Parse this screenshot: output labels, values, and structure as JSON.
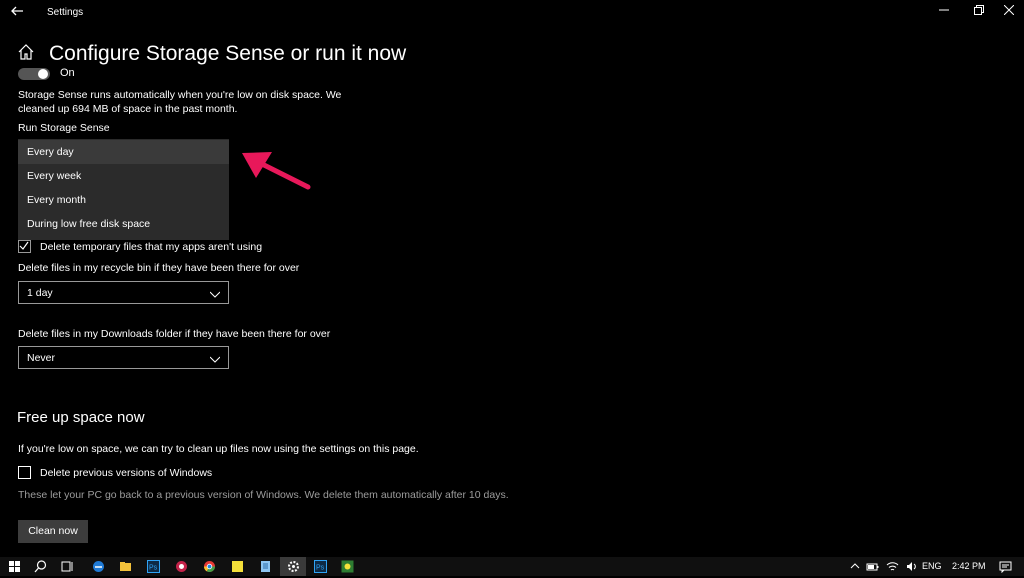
{
  "window": {
    "title": "Settings",
    "back_icon": "back-arrow-icon",
    "controls": [
      "minimize-icon",
      "restore-icon",
      "close-icon"
    ]
  },
  "page": {
    "title": "Configure Storage Sense or run it now",
    "toggle_state": "On",
    "description": "Storage Sense runs automatically when you're low on disk space. We cleaned up 694 MB of space in the past month."
  },
  "run_storage_sense": {
    "label": "Run Storage Sense",
    "options": [
      "Every day",
      "Every week",
      "Every month",
      "During low free disk space"
    ],
    "selected": "Every day"
  },
  "temporary_files": {
    "label": "Delete temporary files that my apps aren't using",
    "checked": true
  },
  "recycle_bin": {
    "label": "Delete files in my recycle bin if they have been there for over",
    "value": "1 day"
  },
  "downloads": {
    "label": "Delete files in my Downloads folder if they have been there for over",
    "value": "Never"
  },
  "free_up": {
    "heading": "Free up space now",
    "description": "If you're low on space, we can try to clean up files now using the settings on this page.",
    "previous_windows_label": "Delete previous versions of Windows",
    "previous_windows_checked": false,
    "hint": "These let your PC go back to a previous version of Windows. We delete them automatically after 10 days.",
    "button": "Clean now"
  },
  "annotation": {
    "arrow_color": "#e8185a"
  },
  "taskbar": {
    "apps": [
      "start-icon",
      "search-icon",
      "task-view-icon",
      "edge-icon",
      "file-explorer-icon",
      "photoshop-icon",
      "app-red-icon",
      "chrome-icon",
      "sticky-notes-icon",
      "notepad-icon",
      "settings-icon",
      "photoshop-icon-2",
      "app-green-icon"
    ],
    "language": "ENG",
    "time": "2:42 PM"
  },
  "colors": {
    "background": "#000000",
    "menu_bg": "#2b2b2b",
    "button_bg": "#3d3d3d",
    "hint_text": "#9c9c9c"
  }
}
